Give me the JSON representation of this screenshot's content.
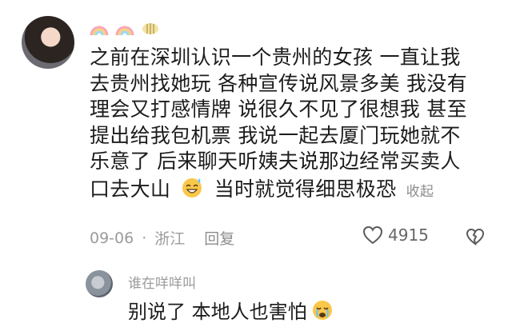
{
  "comment": {
    "badges": [
      "rainbow-badge-icon",
      "rainbow-badge-icon",
      "bee-badge-icon"
    ],
    "lines": [
      "之前在深圳认识一个贵州的女孩 一直让我",
      "去贵州找她玩 各种宣传说风景多美 我没有",
      "理会又打感情牌 说很久不见了很想我 甚至",
      "提出给我包机票 我说一起去厦门玩她就不",
      "乐意了 后来聊天听姨夫说那边经常买卖人",
      "口去大山"
    ],
    "last_line_tail": "当时就觉得细思极恐",
    "collapse_label": "收起",
    "date": "09-06",
    "separator": "·",
    "location": "浙江",
    "reply_label": "回复",
    "like_count": "4915"
  },
  "reply": {
    "username": "谁在咩咩叫",
    "text": "别说了 本地人也害怕"
  }
}
